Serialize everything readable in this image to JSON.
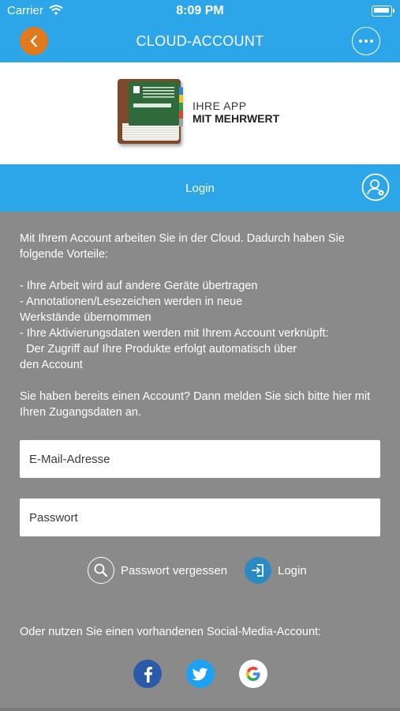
{
  "status_bar": {
    "carrier": "Carrier",
    "time": "8:09 PM"
  },
  "nav": {
    "title": "CLOUD-ACCOUNT",
    "back_icon": "chevron-left-icon",
    "more_icon": "ellipsis-icon"
  },
  "banner": {
    "slogan_line1": "IHRE APP",
    "slogan_line2": "MIT MEHRWERT"
  },
  "section": {
    "title": "Login",
    "profile_icon": "user-settings-icon"
  },
  "content": {
    "intro": "Mit Ihrem Account arbeiten Sie in der Cloud. Dadurch haben Sie folgende Vorteile:",
    "benefits": "- Ihre Arbeit wird auf andere Geräte übertragen\n- Annotationen/Lesezeichen werden in neue\nWerkstände übernommen\n- Ihre Aktivierungsdaten werden mit Ihrem Account verknüpft:\n  Der Zugriff auf Ihre Produkte erfolgt automatisch über\nden Account",
    "existing": "Sie haben bereits einen Account? Dann melden Sie sich bitte hier mit Ihren Zugangsdaten an."
  },
  "form": {
    "email_placeholder": "E-Mail-Adresse",
    "email_value": "",
    "password_placeholder": "Passwort",
    "password_value": "",
    "forgot_label": "Passwort vergessen",
    "login_label": "Login"
  },
  "social": {
    "text": "Oder nutzen Sie einen vorhandenen Social-Media-Account:",
    "items": [
      {
        "name": "facebook-icon"
      },
      {
        "name": "twitter-icon"
      },
      {
        "name": "google-icon"
      }
    ]
  },
  "colors": {
    "accent": "#2ca6e8",
    "back_button": "#e07a1f",
    "background": "#8a8a8a"
  }
}
